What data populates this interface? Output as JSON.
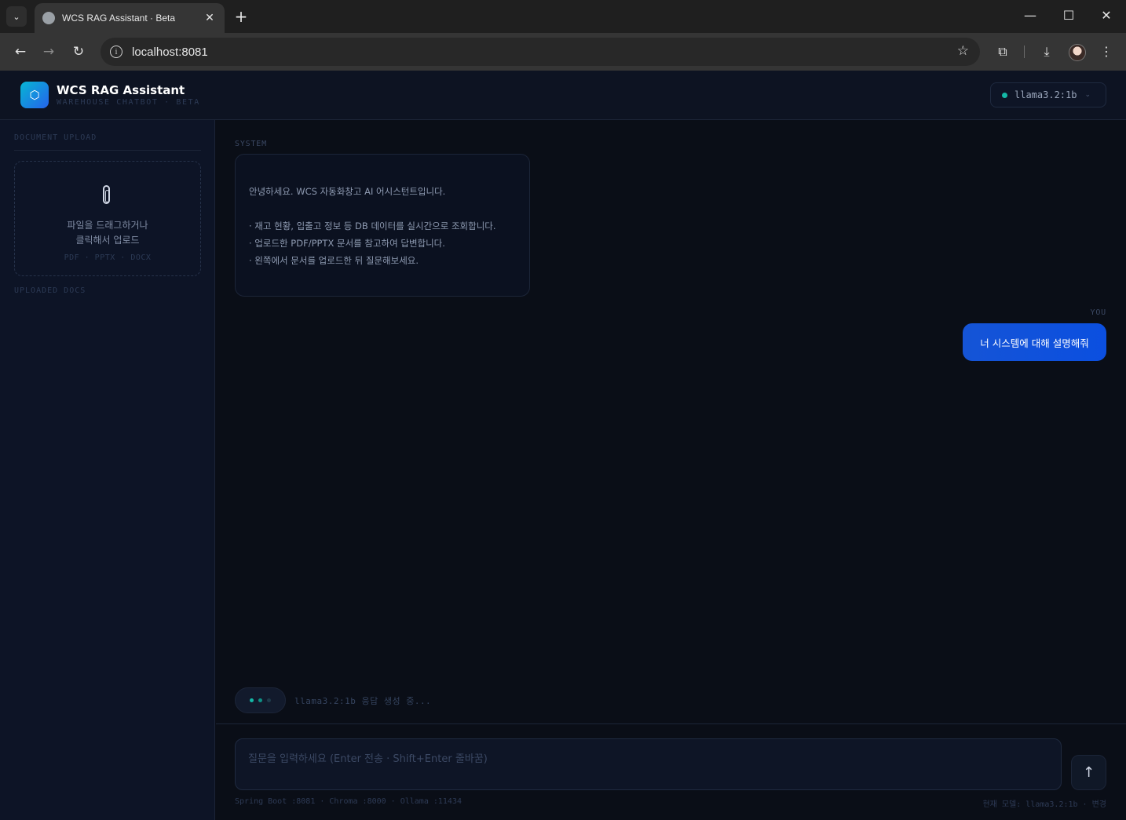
{
  "browser": {
    "tab_title": "WCS RAG Assistant · Beta",
    "url": "localhost:8081",
    "icons": {
      "tab_menu": "chevron-down-icon",
      "favicon": "globe-icon",
      "tab_close": "close-icon",
      "new_tab": "plus-icon",
      "minimize": "minimize-icon",
      "maximize": "maximize-icon",
      "close_window": "close-icon",
      "back": "arrow-left-icon",
      "forward": "arrow-right-icon",
      "reload": "reload-icon",
      "site_info": "info-icon",
      "bookmark": "star-icon",
      "extensions": "puzzle-icon",
      "downloads": "download-icon",
      "profile": "avatar",
      "more": "kebab-icon"
    }
  },
  "header": {
    "logo_glyph": "⬡",
    "title": "WCS RAG Assistant",
    "subtitle": "WAREHOUSE CHATBOT · BETA",
    "model": {
      "name": "llama3.2:1b",
      "caret": "⌄",
      "status_color": "#14b8a6"
    }
  },
  "sidebar": {
    "upload_heading": "DOCUMENT UPLOAD",
    "dropzone_text": "파일을 드래그하거나\n클릭해서 업로드",
    "dropzone_types": "PDF · PPTX · DOCX",
    "docs_heading": "UPLOADED DOCS"
  },
  "chat": {
    "messages": [
      {
        "role_label": "SYSTEM",
        "lines": [
          "안녕하세요. WCS 자동화창고 AI 어시스턴트입니다.",
          "",
          "· 재고 현황, 입출고 정보 등 DB 데이터를 실시간으로 조회합니다.",
          "· 업로드한 PDF/PPTX 문서를 참고하여 답변합니다.",
          "· 왼쪽에서 문서를 업로드한 뒤 질문해보세요."
        ]
      },
      {
        "role_label": "YOU",
        "text": "너 시스템에 대해 설명해줘"
      }
    ],
    "typing": {
      "text": "llama3.2:1b 응답 생성 중...",
      "dot_colors": [
        "#14b8a6",
        "#0f8f84",
        "#1f3b4a"
      ]
    }
  },
  "composer": {
    "placeholder": "질문을 입력하세요 (Enter 전송 · Shift+Enter 줄바꿈)",
    "value": "",
    "send_glyph": "↑",
    "footer_left": "Spring Boot :8081 · Chroma :8000 · Ollama :11434",
    "footer_right": "현재 모델: llama3.2:1b · 변경"
  },
  "colors": {
    "accent": "#0b4fe0",
    "teal": "#14b8a6",
    "background": "#0a0e17"
  }
}
